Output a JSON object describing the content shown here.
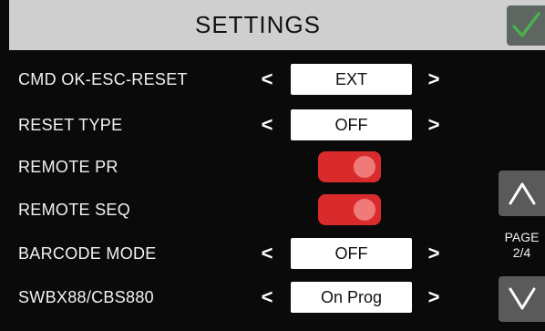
{
  "header": {
    "title": "SETTINGS"
  },
  "colors": {
    "header_bg": "#cfcfcf",
    "confirm_check": "#4caf50",
    "toggle_on": "#d92b2b",
    "value_bg": "#ffffff"
  },
  "settings": [
    {
      "label": "CMD OK-ESC-RESET",
      "kind": "select",
      "value": "EXT"
    },
    {
      "label": "RESET TYPE",
      "kind": "select",
      "value": "OFF"
    },
    {
      "label": "REMOTE PR",
      "kind": "toggle",
      "on": true
    },
    {
      "label": "REMOTE SEQ",
      "kind": "toggle",
      "on": true
    },
    {
      "label": "BARCODE MODE",
      "kind": "select",
      "value": "OFF"
    },
    {
      "label": "SWBX88/CBS880",
      "kind": "select",
      "value": "On Prog"
    }
  ],
  "arrows": {
    "prev": "<",
    "next": ">"
  },
  "pager": {
    "label": "PAGE",
    "value": "2/4"
  },
  "icons": {
    "confirm": "check-icon",
    "page_up": "chevron-up-icon",
    "page_down": "chevron-down-icon"
  }
}
